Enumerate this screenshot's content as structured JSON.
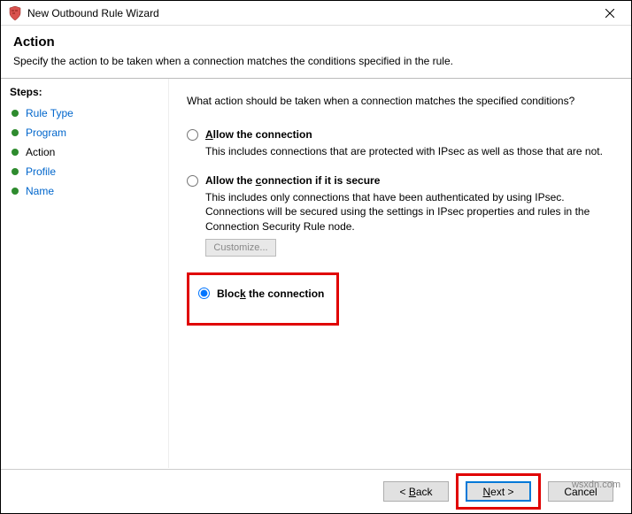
{
  "titlebar": {
    "title": "New Outbound Rule Wizard"
  },
  "header": {
    "heading": "Action",
    "subtitle": "Specify the action to be taken when a connection matches the conditions specified in the rule."
  },
  "sidebar": {
    "title": "Steps:",
    "items": [
      {
        "label": "Rule Type",
        "current": false
      },
      {
        "label": "Program",
        "current": false
      },
      {
        "label": "Action",
        "current": true
      },
      {
        "label": "Profile",
        "current": false
      },
      {
        "label": "Name",
        "current": false
      }
    ]
  },
  "main": {
    "prompt": "What action should be taken when a connection matches the specified conditions?",
    "options": [
      {
        "id": "allow",
        "label_pre": "A",
        "label_rest": "llow the connection",
        "desc": "This includes connections that are protected with IPsec as well as those that are not.",
        "checked": false
      },
      {
        "id": "allow_secure",
        "label_pre": "Allow the ",
        "label_u": "c",
        "label_rest": "onnection if it is secure",
        "desc": "This includes only connections that have been authenticated by using IPsec. Connections will be secured using the settings in IPsec properties and rules in the Connection Security Rule node.",
        "checked": false,
        "customize": "Customize..."
      },
      {
        "id": "block",
        "label_pre": "Bloc",
        "label_u": "k",
        "label_rest": " the connection",
        "checked": true,
        "highlighted": true
      }
    ]
  },
  "footer": {
    "back": "< Back",
    "next": "Next >",
    "cancel": "Cancel"
  },
  "watermark": "wsxdn.com"
}
